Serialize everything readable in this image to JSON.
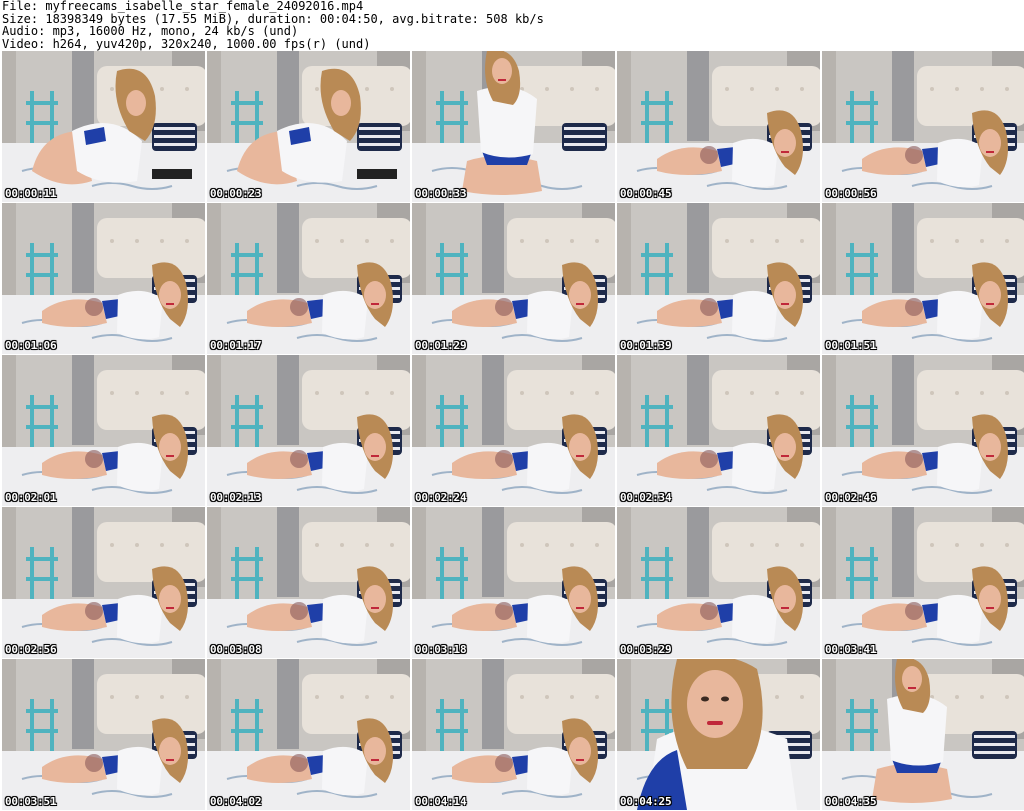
{
  "header": {
    "file_line": "File: myfreecams_isabelle_star_female_24092016.mp4",
    "size_line": "Size: 18398349 bytes (17.55 MiB), duration: 00:04:50, avg.bitrate: 508 kb/s",
    "audio_line": "Audio: mp3, 16000 Hz, mono, 24 kb/s (und)",
    "video_line": "Video: h264, yuv420p, 320x240, 1000.00 fps(r) (und)"
  },
  "thumbnails": [
    {
      "timestamp": "00:00:11",
      "pose": "kneel"
    },
    {
      "timestamp": "00:00:23",
      "pose": "kneel"
    },
    {
      "timestamp": "00:00:33",
      "pose": "sit"
    },
    {
      "timestamp": "00:00:45",
      "pose": "lie"
    },
    {
      "timestamp": "00:00:56",
      "pose": "lie"
    },
    {
      "timestamp": "00:01:06",
      "pose": "lie"
    },
    {
      "timestamp": "00:01:17",
      "pose": "lie"
    },
    {
      "timestamp": "00:01:29",
      "pose": "lie"
    },
    {
      "timestamp": "00:01:39",
      "pose": "lie"
    },
    {
      "timestamp": "00:01:51",
      "pose": "lie"
    },
    {
      "timestamp": "00:02:01",
      "pose": "lie"
    },
    {
      "timestamp": "00:02:13",
      "pose": "lie"
    },
    {
      "timestamp": "00:02:24",
      "pose": "lie"
    },
    {
      "timestamp": "00:02:34",
      "pose": "lie"
    },
    {
      "timestamp": "00:02:46",
      "pose": "lie"
    },
    {
      "timestamp": "00:02:56",
      "pose": "lie"
    },
    {
      "timestamp": "00:03:08",
      "pose": "lie"
    },
    {
      "timestamp": "00:03:18",
      "pose": "lie"
    },
    {
      "timestamp": "00:03:29",
      "pose": "lie"
    },
    {
      "timestamp": "00:03:41",
      "pose": "lie"
    },
    {
      "timestamp": "00:03:51",
      "pose": "lie"
    },
    {
      "timestamp": "00:04:02",
      "pose": "lie"
    },
    {
      "timestamp": "00:04:14",
      "pose": "lie"
    },
    {
      "timestamp": "00:04:25",
      "pose": "close"
    },
    {
      "timestamp": "00:04:35",
      "pose": "sit"
    }
  ],
  "colors": {
    "wall": "#c9c6c2",
    "curtain": "#8f8f93",
    "headboard": "#e8e2da",
    "shelf": "#4fb3bf",
    "bed": "#eeeef0",
    "shirt": "#f6f6f8",
    "shorts": "#1f3fa8",
    "skin": "#e8b79c",
    "hair": "#b98a55"
  }
}
